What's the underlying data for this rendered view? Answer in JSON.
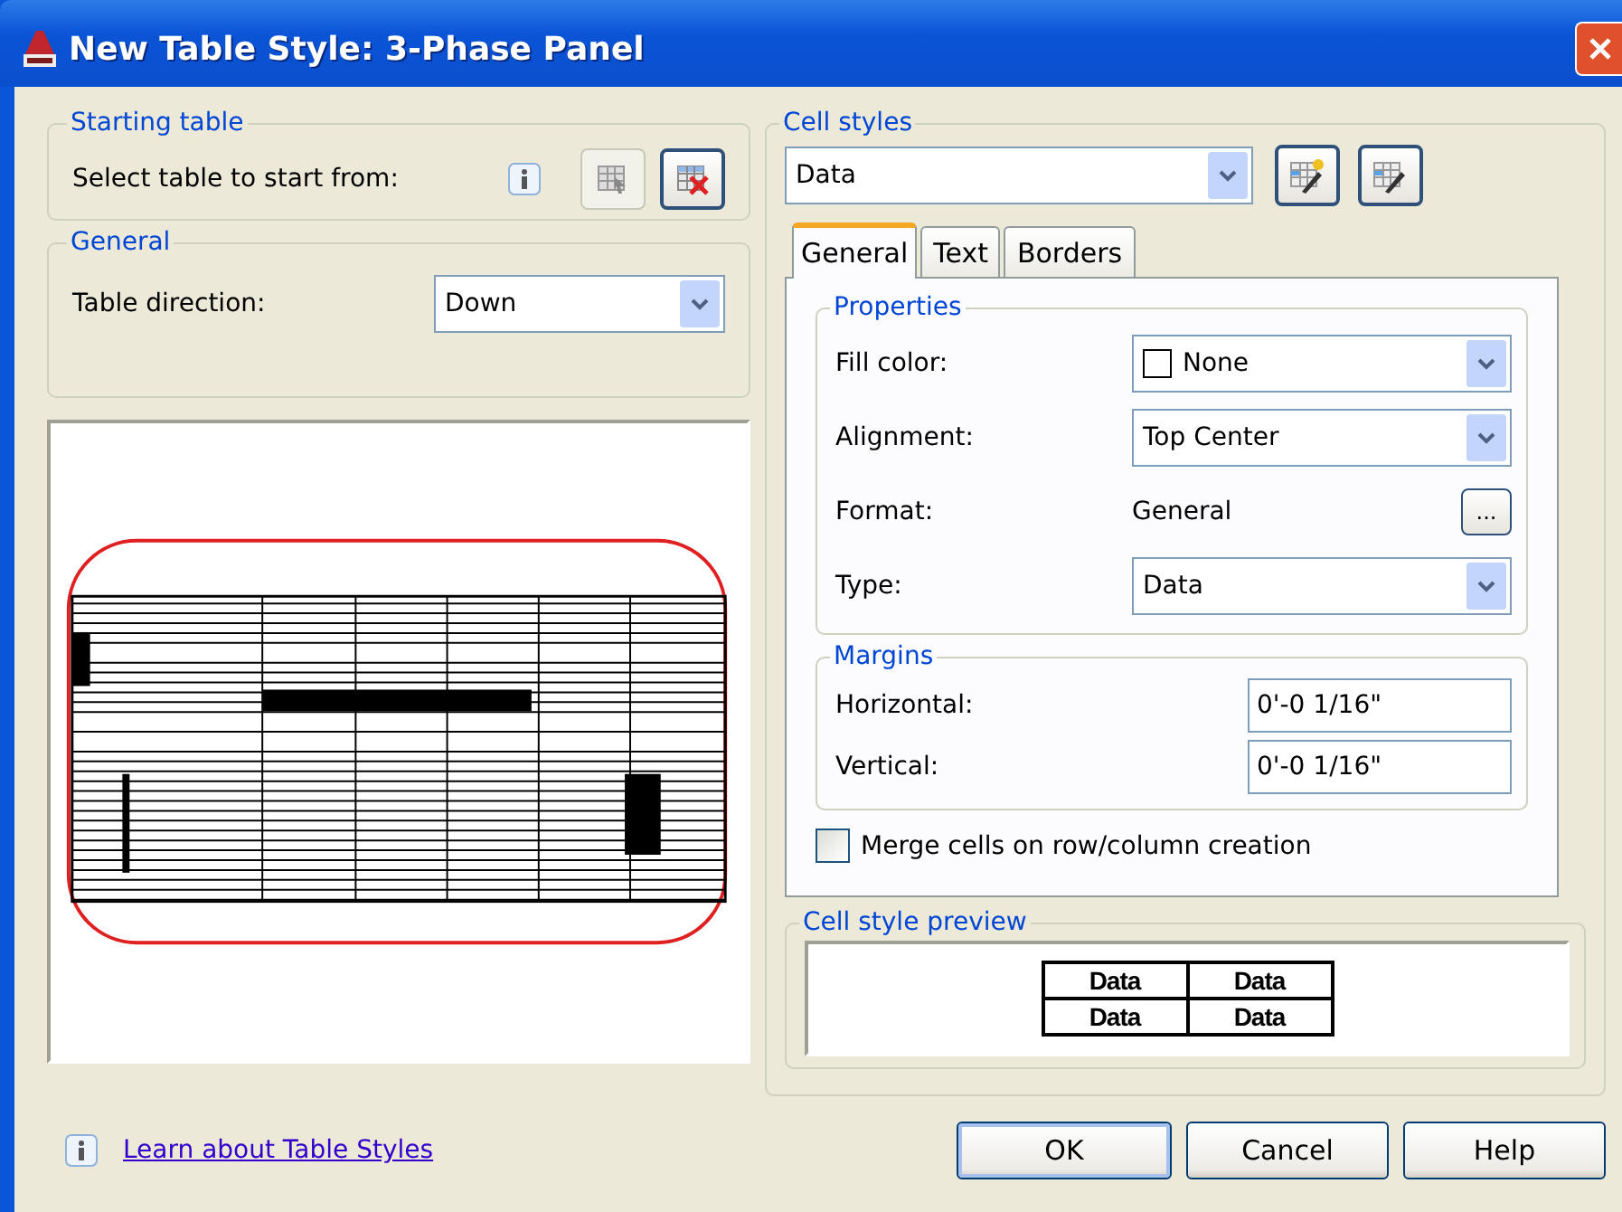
{
  "window": {
    "title": "New Table Style: 3-Phase Panel"
  },
  "starting_table": {
    "legend": "Starting table",
    "label": "Select table to start from:"
  },
  "general": {
    "legend": "General",
    "label": "Table direction:",
    "value": "Down"
  },
  "cell_styles": {
    "legend": "Cell styles",
    "value": "Data"
  },
  "tabs": [
    {
      "label": "General",
      "selected": true
    },
    {
      "label": "Text",
      "selected": false
    },
    {
      "label": "Borders",
      "selected": false
    }
  ],
  "properties": {
    "legend": "Properties",
    "rows": [
      {
        "kind": "color",
        "label": "Fill color:",
        "value": "None"
      },
      {
        "kind": "dropdown",
        "label": "Alignment:",
        "value": "Top Center"
      },
      {
        "kind": "button",
        "label": "Format:",
        "value": "General",
        "button": "..."
      },
      {
        "kind": "dropdown",
        "label": "Type:",
        "value": "Data"
      }
    ]
  },
  "margins": {
    "legend": "Margins",
    "rows": [
      {
        "label": "Horizontal:",
        "value": "0'-0 1/16\""
      },
      {
        "label": "Vertical:",
        "value": "0'-0 1/16\""
      }
    ]
  },
  "merge": {
    "label": "Merge cells on row/column creation",
    "checked": false
  },
  "preview": {
    "legend": "Cell style preview",
    "cells": [
      [
        "Data",
        "Data"
      ],
      [
        "Data",
        "Data"
      ]
    ]
  },
  "link": "Learn about Table Styles",
  "buttons": [
    {
      "label": "OK",
      "default": true
    },
    {
      "label": "Cancel",
      "default": false
    },
    {
      "label": "Help",
      "default": false
    }
  ]
}
